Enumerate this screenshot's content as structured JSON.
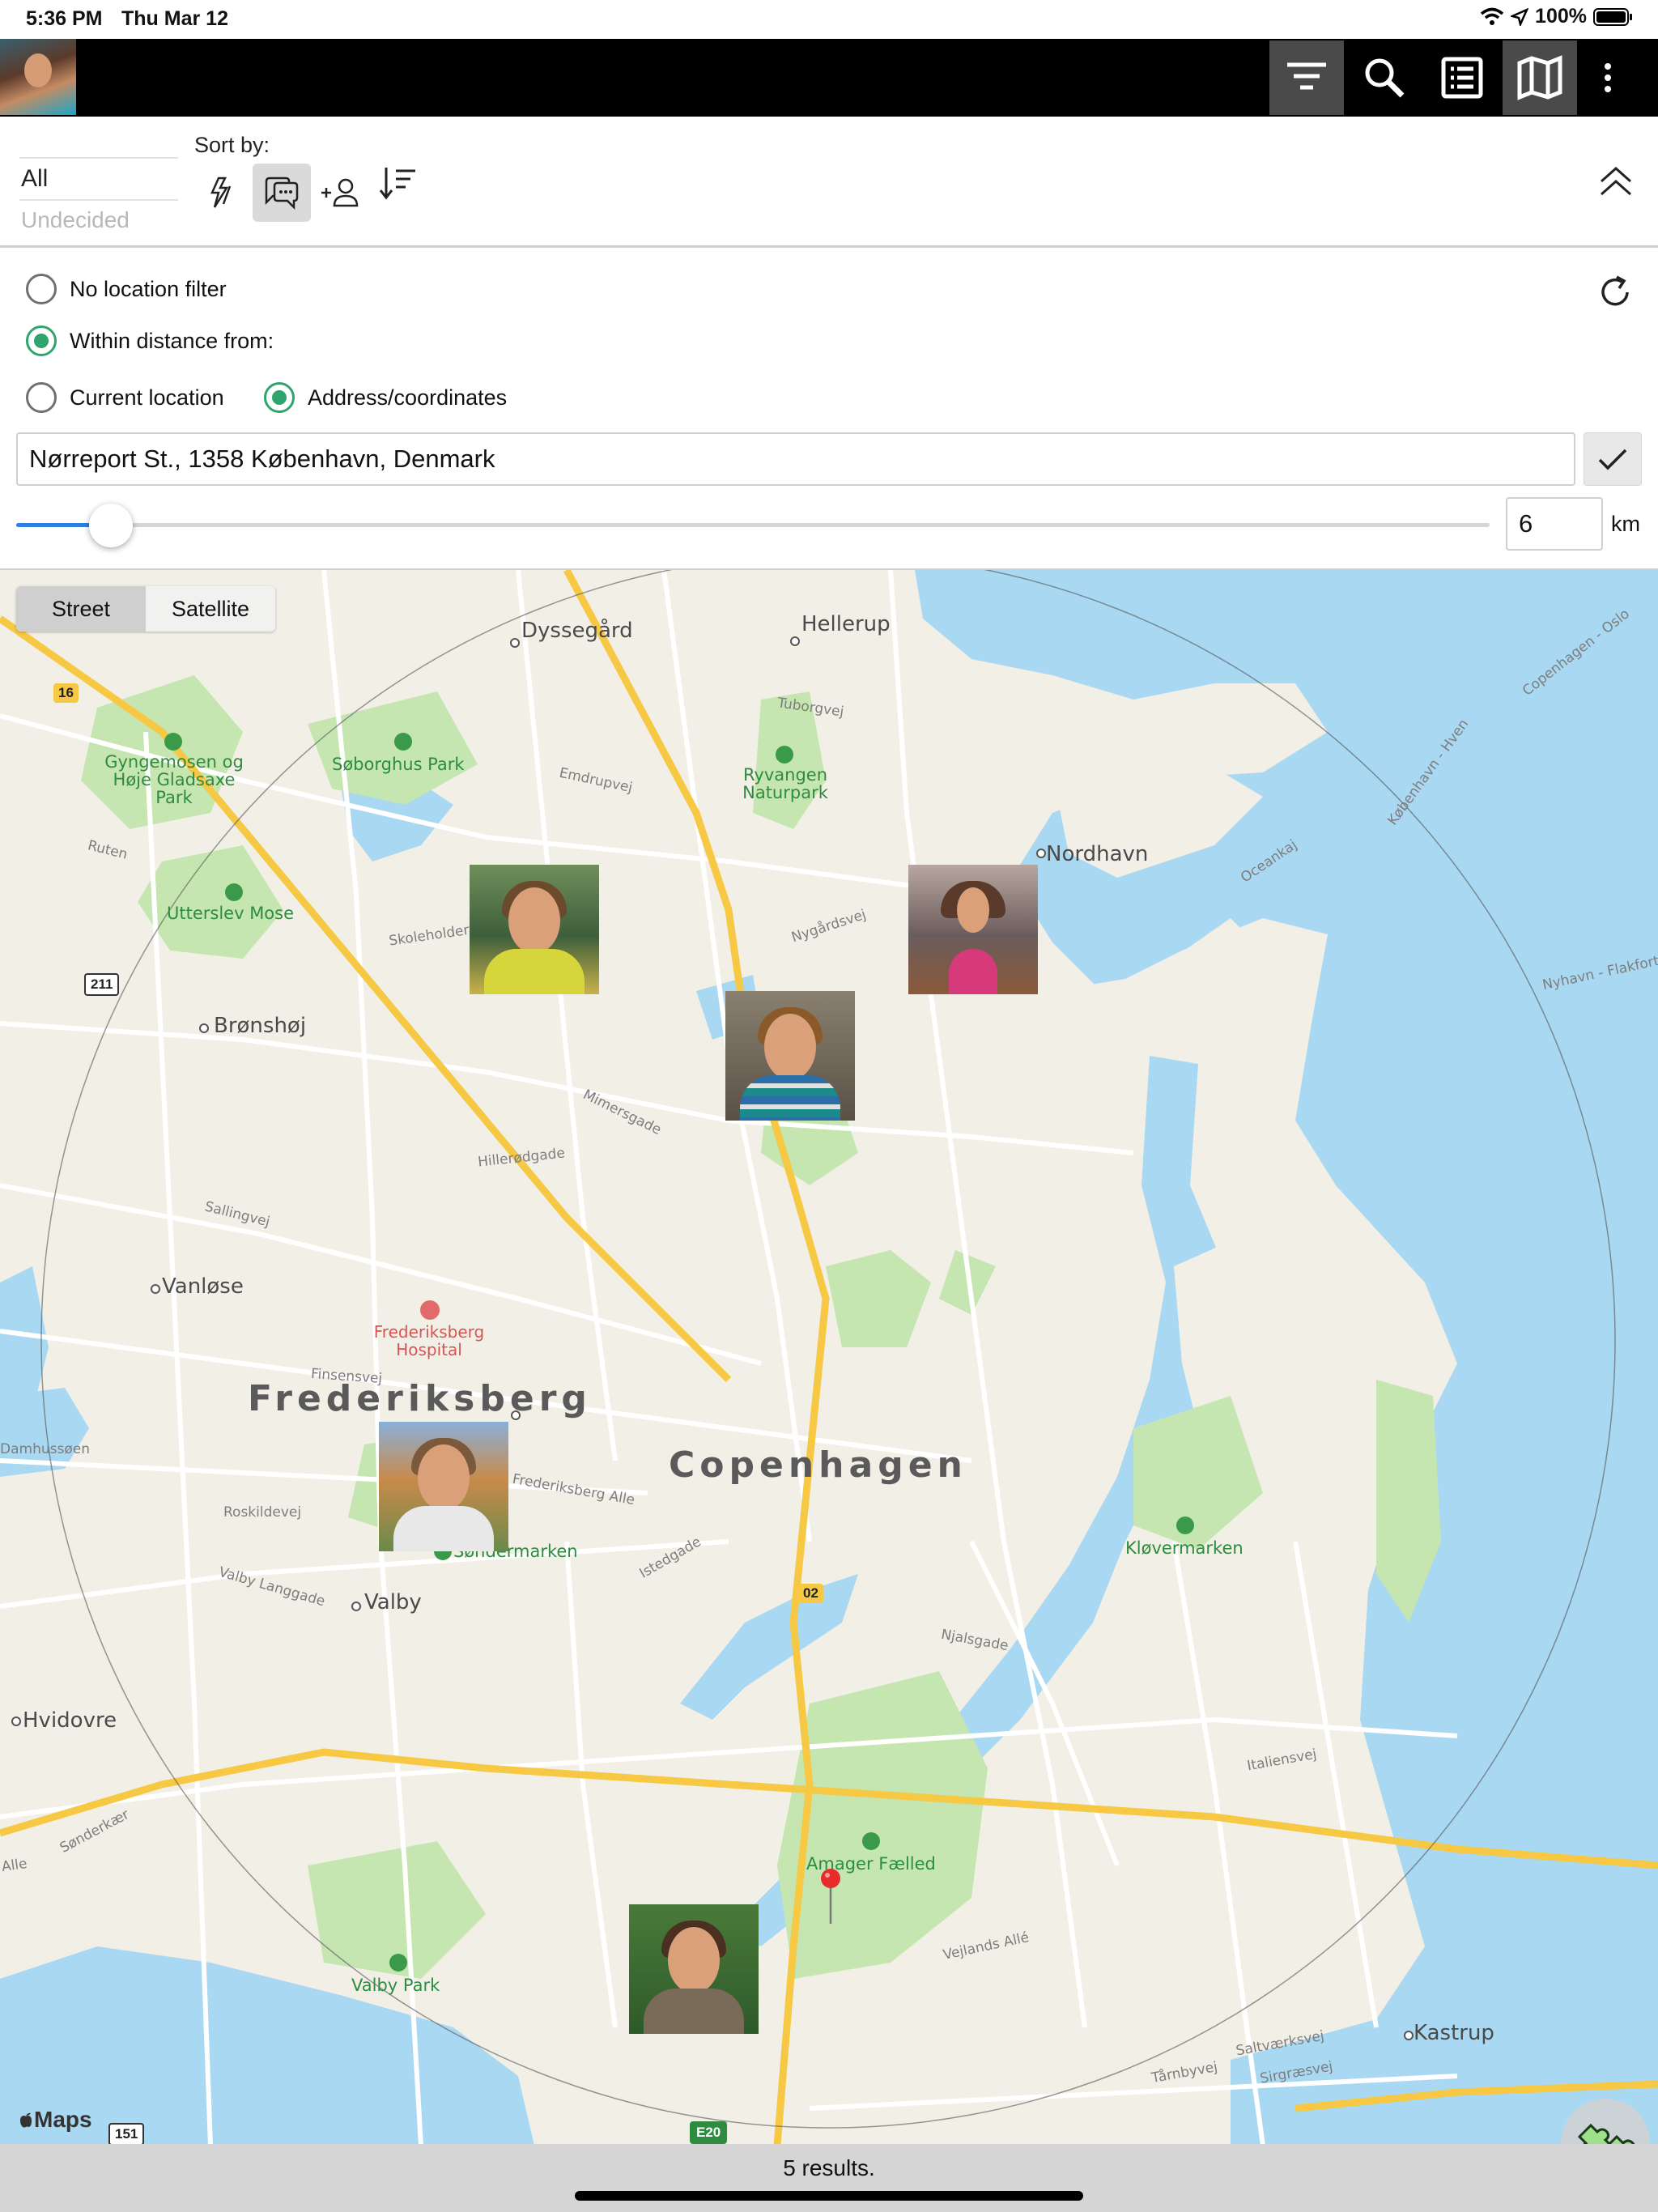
{
  "status": {
    "time": "5:36 PM",
    "date": "Thu Mar 12",
    "battery": "100%"
  },
  "toolbar": {
    "icons": [
      "filter-icon",
      "search-icon",
      "list-icon",
      "map-icon",
      "more-icon"
    ],
    "active": [
      "filter",
      "map"
    ]
  },
  "filter": {
    "options": [
      "All",
      "Undecided"
    ],
    "sort_label": "Sort by:",
    "sort_icons": [
      "activity-icon",
      "messages-icon",
      "add-person-icon",
      "sort-order-icon"
    ],
    "active_sort": "messages"
  },
  "location": {
    "no_filter": "No location filter",
    "within": "Within distance from:",
    "current": "Current location",
    "address_option": "Address/coordinates",
    "address": "Nørreport St., 1358 København, Denmark",
    "distance": "6",
    "unit": "km",
    "slider_fraction": 0.06,
    "selected": {
      "filter": "within",
      "source": "address"
    }
  },
  "map": {
    "types": [
      "Street",
      "Satellite"
    ],
    "selected_type": "Street",
    "labels": {
      "dyssegard": "Dyssegård",
      "hellerup": "Hellerup",
      "tuborgvej": "Tuborgvej",
      "emdrupvej": "Emdrupvej",
      "gyngemosen": "Gyngemosen og Høje Gladsaxe Park",
      "soborghus": "Søborghus Park",
      "ryvangen": "Ryvangen Naturpark",
      "nordhavn": "Nordhavn",
      "ruten": "Ruten",
      "utterslev": "Utterslev Mose",
      "bronshoj": "Brønshøj",
      "vanlose": "Vanløse",
      "frederiksberg_hospital": "Frederiksberg Hospital",
      "frederiksberg": "Frederiksberg",
      "copenhagen": "Copenhagen",
      "valby": "Valby",
      "hvidovre": "Hvidovre",
      "sondermarken": "Søndermarken",
      "klovermarken": "Kløvermarken",
      "amager_faelled": "Amager Fælled",
      "valby_park": "Valby Park",
      "kastrup": "Kastrup",
      "skoleholdervej": "Skoleholdervej",
      "nygardsvej": "Nygårdsvej",
      "mimersgade": "Mimersgade",
      "hillerodgade": "Hillerødgade",
      "sallingvej": "Sallingvej",
      "finsensvej": "Finsensvej",
      "roskildevej": "Roskildevej",
      "frederiksberg_alle": "Frederiksberg Alle",
      "istedgade": "Istedgade",
      "valby_langgade": "Valby Langgade",
      "njalsgade": "Njalsgade",
      "italiensvej": "Italiensvej",
      "vejlands_alle": "Vejlands Allé",
      "saltvaerksvej": "Saltværksvej",
      "sirgraesvej": "Sirgræsvej",
      "tarnbyvej": "Tårnbyvej",
      "oceankaj": "Oceankaj",
      "nyhavn_flakfort": "Nyhavn - Flakfort",
      "copenhagen_oslo": "Copenhagen - Oslo",
      "kobenhavn_hven": "København - Hven",
      "damhussoen": "Damhussøen",
      "alle": "Alle",
      "sonderkaer": "Sønderkær"
    },
    "shields": [
      "16",
      "211",
      "02",
      "151",
      "E20"
    ],
    "maps_logo": "Maps"
  },
  "results": "5 results.",
  "colors": {
    "accent_green": "#2fa46c",
    "slider_blue": "#2f7fe0",
    "water": "#a9d8f2",
    "park": "#c5e6b0",
    "land": "#f2efe6",
    "road_major": "#f6c843",
    "road_minor": "#ffffff"
  }
}
